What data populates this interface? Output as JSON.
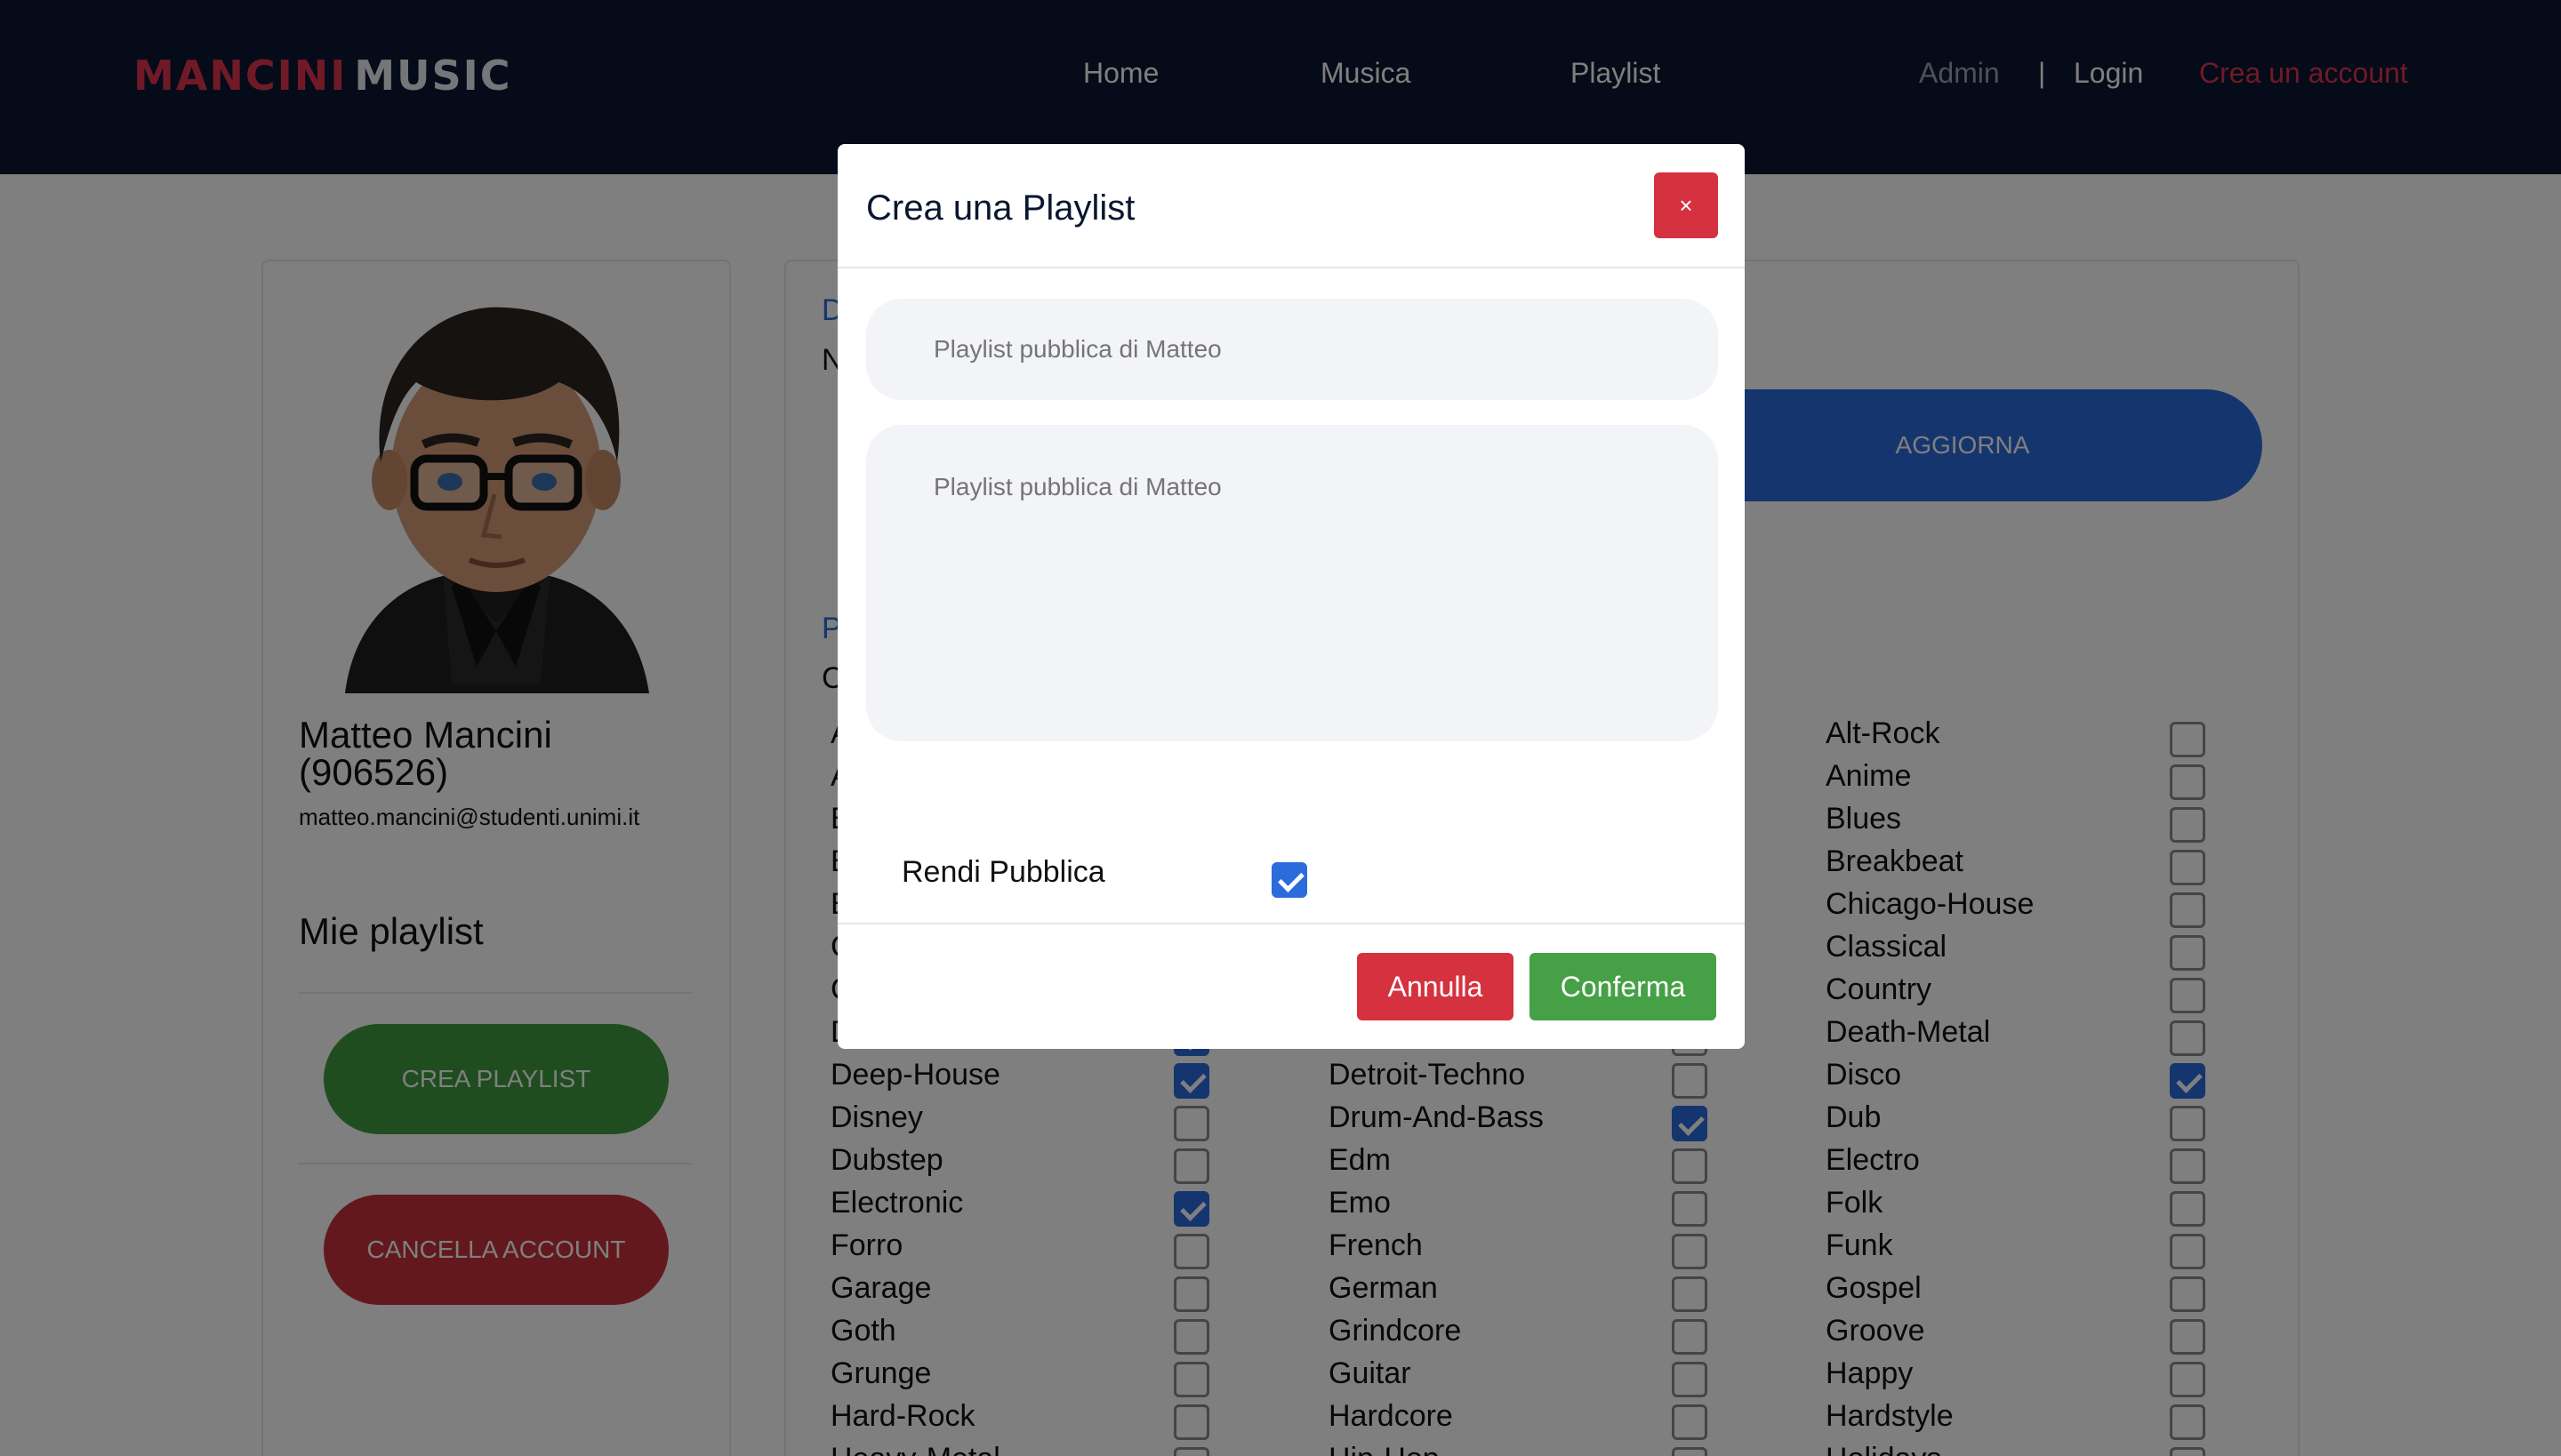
{
  "navbar": {
    "brand_part1": "MANCINI",
    "brand_part2": "MUSIC",
    "links": {
      "home": "Home",
      "musica": "Musica",
      "playlist": "Playlist"
    },
    "admin": "Admin",
    "separator": "|",
    "login": "Login",
    "crea_account": "Crea un account",
    "colors": {
      "background": "#0a1730",
      "accent": "#e0344f"
    }
  },
  "profile": {
    "name_line1": "Matteo Mancini",
    "name_line2": "(906526)",
    "email": "matteo.mancini@studenti.unimi.it",
    "playlists_title": "Mie playlist",
    "crea_playlist_button": "CREA PLAYLIST",
    "cancella_account_button": "CANCELLA ACCOUNT",
    "avatar_icon": "user-avatar-cartoon"
  },
  "settings": {
    "aggiorna_button": "AGGIORNA",
    "fragments": {
      "d": "D",
      "n": "N",
      "p": "P",
      "c": "C"
    }
  },
  "genres": {
    "column1": [
      {
        "label": "A",
        "checked": false
      },
      {
        "label": "A",
        "checked": false
      },
      {
        "label": "B",
        "checked": false
      },
      {
        "label": "B",
        "checked": false
      },
      {
        "label": "B",
        "checked": false
      },
      {
        "label": "C",
        "checked": false
      },
      {
        "label": "C",
        "checked": false
      },
      {
        "label": "D",
        "checked": true
      },
      {
        "label": "Deep-House",
        "checked": true
      },
      {
        "label": "Disney",
        "checked": false
      },
      {
        "label": "Dubstep",
        "checked": false
      },
      {
        "label": "Electronic",
        "checked": true
      },
      {
        "label": "Forro",
        "checked": false
      },
      {
        "label": "Garage",
        "checked": false
      },
      {
        "label": "Goth",
        "checked": false
      },
      {
        "label": "Grunge",
        "checked": false
      },
      {
        "label": "Hard-Rock",
        "checked": false
      },
      {
        "label": "Heavy-Metal",
        "checked": false
      }
    ],
    "column2": [
      {
        "label": "",
        "checked": false
      },
      {
        "label": "",
        "checked": false
      },
      {
        "label": "",
        "checked": false
      },
      {
        "label": "",
        "checked": false
      },
      {
        "label": "",
        "checked": false
      },
      {
        "label": "",
        "checked": false
      },
      {
        "label": "",
        "checked": false
      },
      {
        "label": "",
        "checked": false
      },
      {
        "label": "Detroit-Techno",
        "checked": false
      },
      {
        "label": "Drum-And-Bass",
        "checked": true
      },
      {
        "label": "Edm",
        "checked": false
      },
      {
        "label": "Emo",
        "checked": false
      },
      {
        "label": "French",
        "checked": false
      },
      {
        "label": "German",
        "checked": false
      },
      {
        "label": "Grindcore",
        "checked": false
      },
      {
        "label": "Guitar",
        "checked": false
      },
      {
        "label": "Hardcore",
        "checked": false
      },
      {
        "label": "Hip-Hop",
        "checked": false
      }
    ],
    "column3": [
      {
        "label": "Alt-Rock",
        "checked": false
      },
      {
        "label": "Anime",
        "checked": false
      },
      {
        "label": "Blues",
        "checked": false
      },
      {
        "label": "Breakbeat",
        "checked": false
      },
      {
        "label": "Chicago-House",
        "checked": false
      },
      {
        "label": "Classical",
        "checked": false
      },
      {
        "label": "Country",
        "checked": false
      },
      {
        "label": "Death-Metal",
        "checked": false
      },
      {
        "label": "Disco",
        "checked": true
      },
      {
        "label": "Dub",
        "checked": false
      },
      {
        "label": "Electro",
        "checked": false
      },
      {
        "label": "Folk",
        "checked": false
      },
      {
        "label": "Funk",
        "checked": false
      },
      {
        "label": "Gospel",
        "checked": false
      },
      {
        "label": "Groove",
        "checked": false
      },
      {
        "label": "Happy",
        "checked": false
      },
      {
        "label": "Hardstyle",
        "checked": false
      },
      {
        "label": "Holidays",
        "checked": false
      }
    ]
  },
  "modal": {
    "title": "Crea una Playlist",
    "close_label": "×",
    "name_placeholder": "Playlist pubblica di Matteo",
    "description_placeholder": "Playlist pubblica di Matteo",
    "public_label": "Rendi Pubblica",
    "public_checked": true,
    "annulla_button": "Annulla",
    "conferma_button": "Conferma"
  }
}
